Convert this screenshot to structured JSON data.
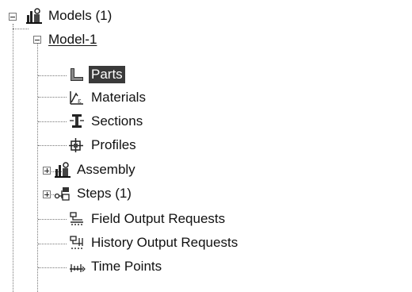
{
  "tree": {
    "root": {
      "label": "Models (1)",
      "icon": "models-icon",
      "expanded": true
    },
    "model": {
      "label": "Model-1",
      "expanded": true
    },
    "items": [
      {
        "label": "Parts",
        "icon": "parts-icon",
        "selected": true
      },
      {
        "label": "Materials",
        "icon": "materials-icon"
      },
      {
        "label": "Sections",
        "icon": "sections-icon"
      },
      {
        "label": "Profiles",
        "icon": "profiles-icon"
      },
      {
        "label": "Assembly",
        "icon": "assembly-icon",
        "expandable": true
      },
      {
        "label": "Steps (1)",
        "icon": "steps-icon",
        "expandable": true
      },
      {
        "label": "Field Output Requests",
        "icon": "field-output-icon"
      },
      {
        "label": "History Output Requests",
        "icon": "history-output-icon"
      },
      {
        "label": "Time Points",
        "icon": "time-points-icon"
      }
    ]
  }
}
